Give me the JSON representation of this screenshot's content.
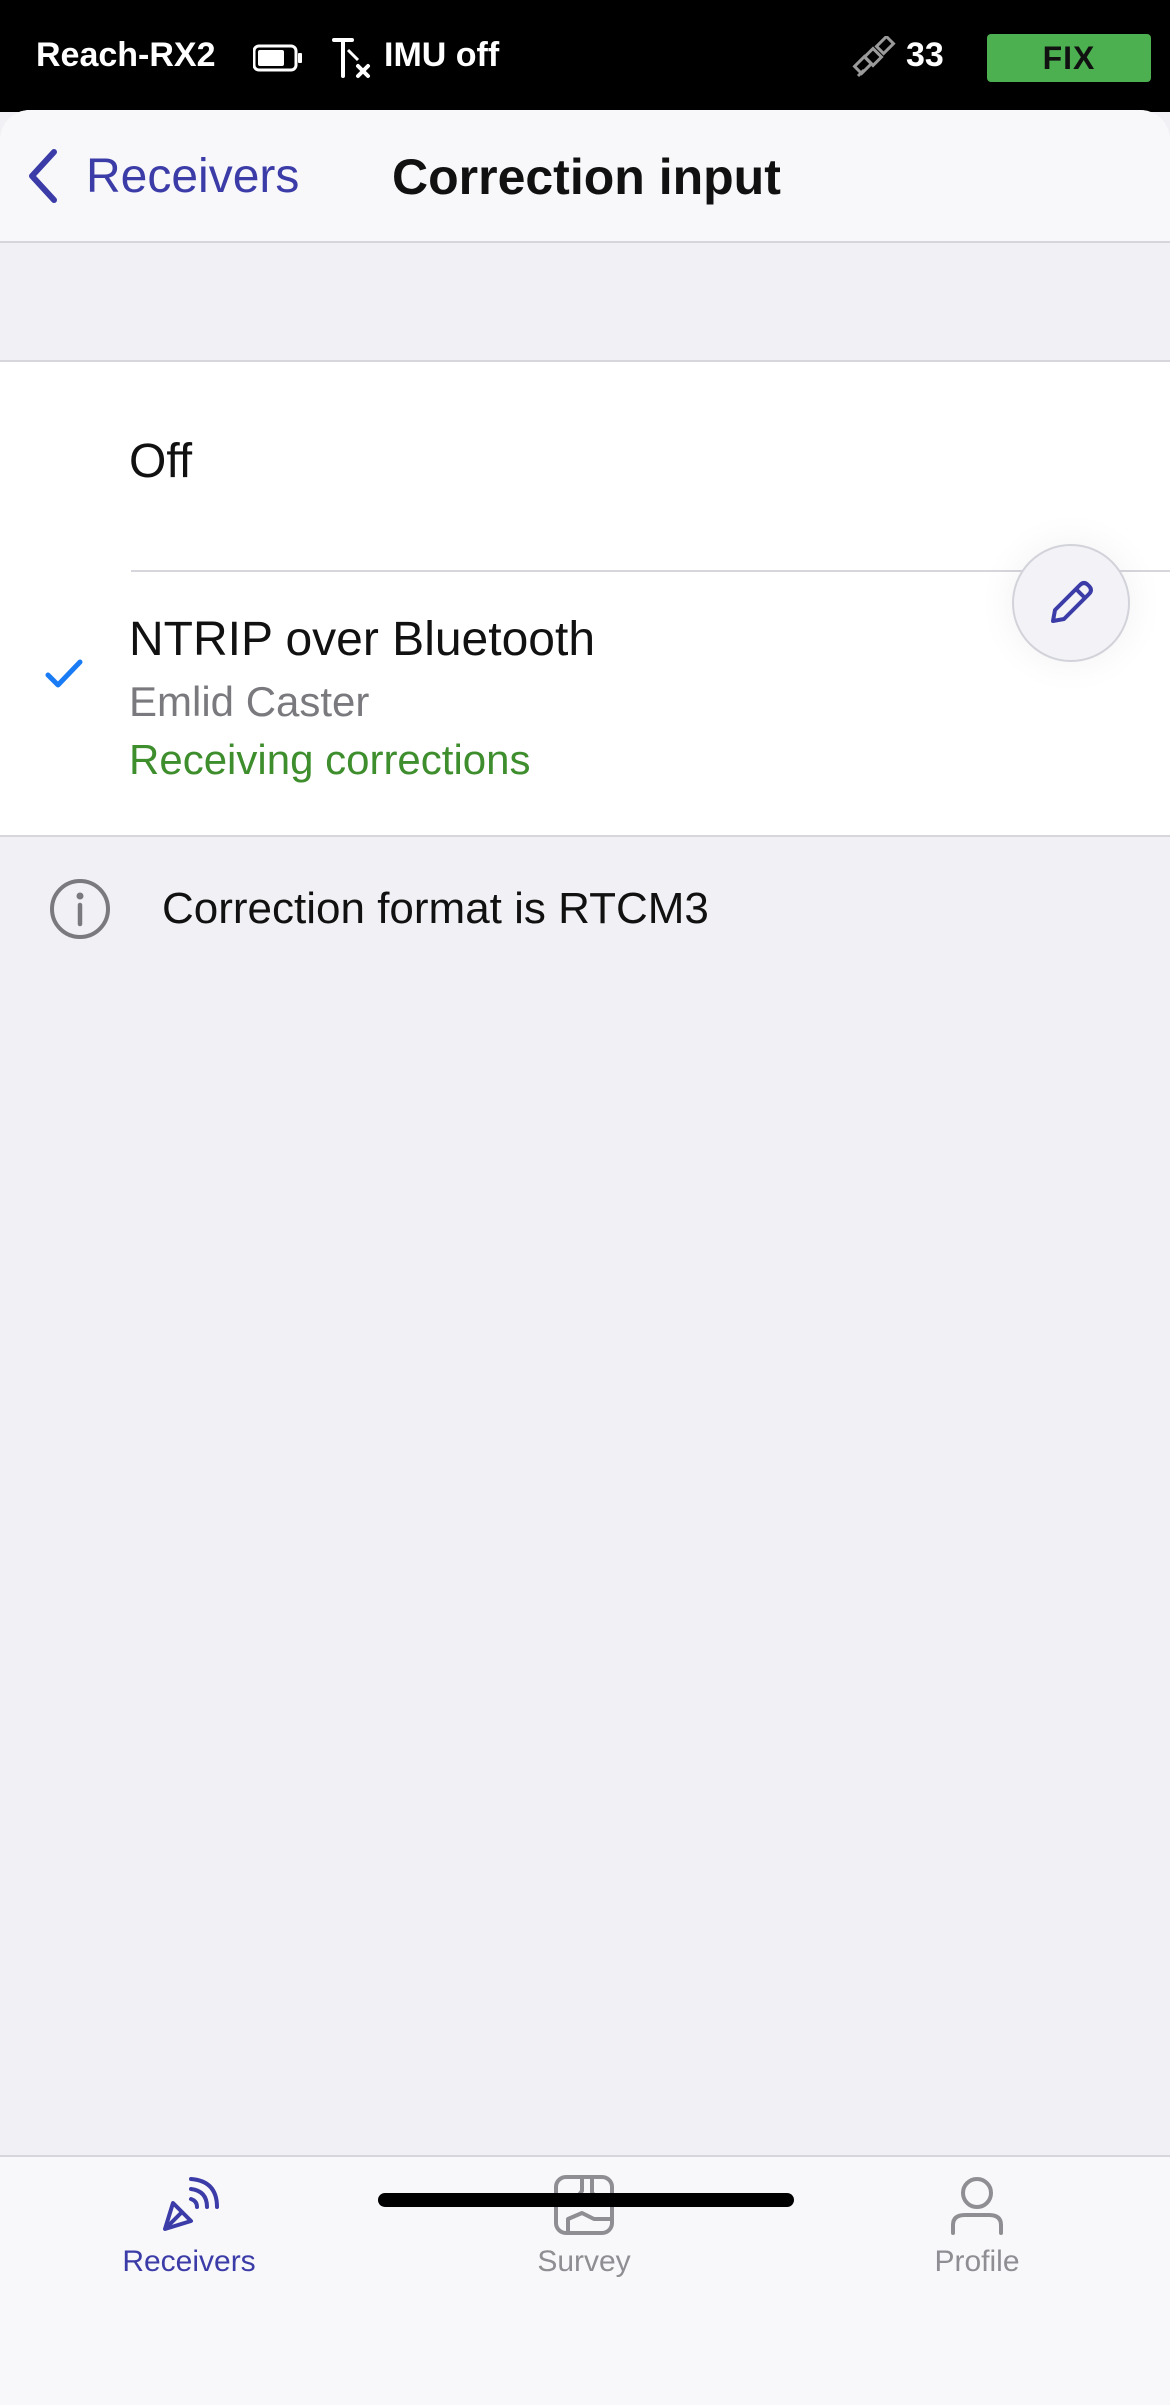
{
  "status_bar": {
    "device_name": "Reach-RX2",
    "battery_icon": "battery-icon",
    "imu_icon": "imu-off-icon",
    "imu_label": "IMU off",
    "satellite_icon": "satellite-icon",
    "satellite_count": "33",
    "fix_label": "FIX",
    "fix_color": "#4caf50"
  },
  "nav": {
    "back_label": "Receivers",
    "title": "Correction input",
    "accent_color": "#3c3ca8"
  },
  "options": {
    "off_label": "Off",
    "ntrip": {
      "title": "NTRIP over Bluetooth",
      "subtitle": "Emlid Caster",
      "status": "Receiving corrections",
      "status_color": "#3e8e2e",
      "selected": true,
      "edit_icon": "pencil-icon"
    }
  },
  "info": {
    "icon": "info-icon",
    "text": "Correction format is RTCM3"
  },
  "tabs": [
    {
      "label": "Receivers",
      "icon": "receivers-icon",
      "active": true
    },
    {
      "label": "Survey",
      "icon": "survey-map-icon",
      "active": false
    },
    {
      "label": "Profile",
      "icon": "profile-icon",
      "active": false
    }
  ]
}
